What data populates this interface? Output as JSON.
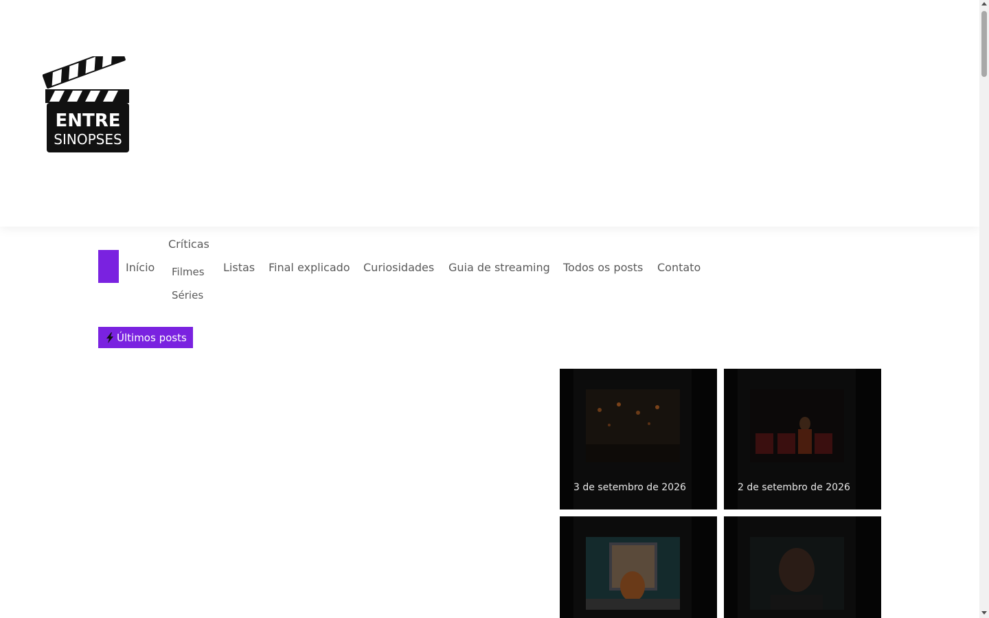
{
  "site": {
    "logo_line1": "ENTRE",
    "logo_line2": "SINOPSES",
    "logo_icon": "clapperboard-icon"
  },
  "nav": {
    "home_icon": "home-square",
    "items": [
      {
        "label": "Início"
      },
      {
        "label": "Críticas",
        "sub": [
          "Filmes",
          "Séries"
        ]
      },
      {
        "label": "Listas"
      },
      {
        "label": "Final explicado"
      },
      {
        "label": "Curiosidades"
      },
      {
        "label": "Guia de streaming"
      },
      {
        "label": "Todos os posts"
      },
      {
        "label": "Contato"
      }
    ]
  },
  "latest": {
    "label": "Últimos posts",
    "icon": "lightning-icon"
  },
  "posts": [
    {
      "date": "3 de setembro de 2026"
    },
    {
      "date": "2 de setembro de 2026"
    },
    {
      "date": ""
    },
    {
      "date": ""
    }
  ],
  "colors": {
    "accent": "#7a22e0"
  }
}
